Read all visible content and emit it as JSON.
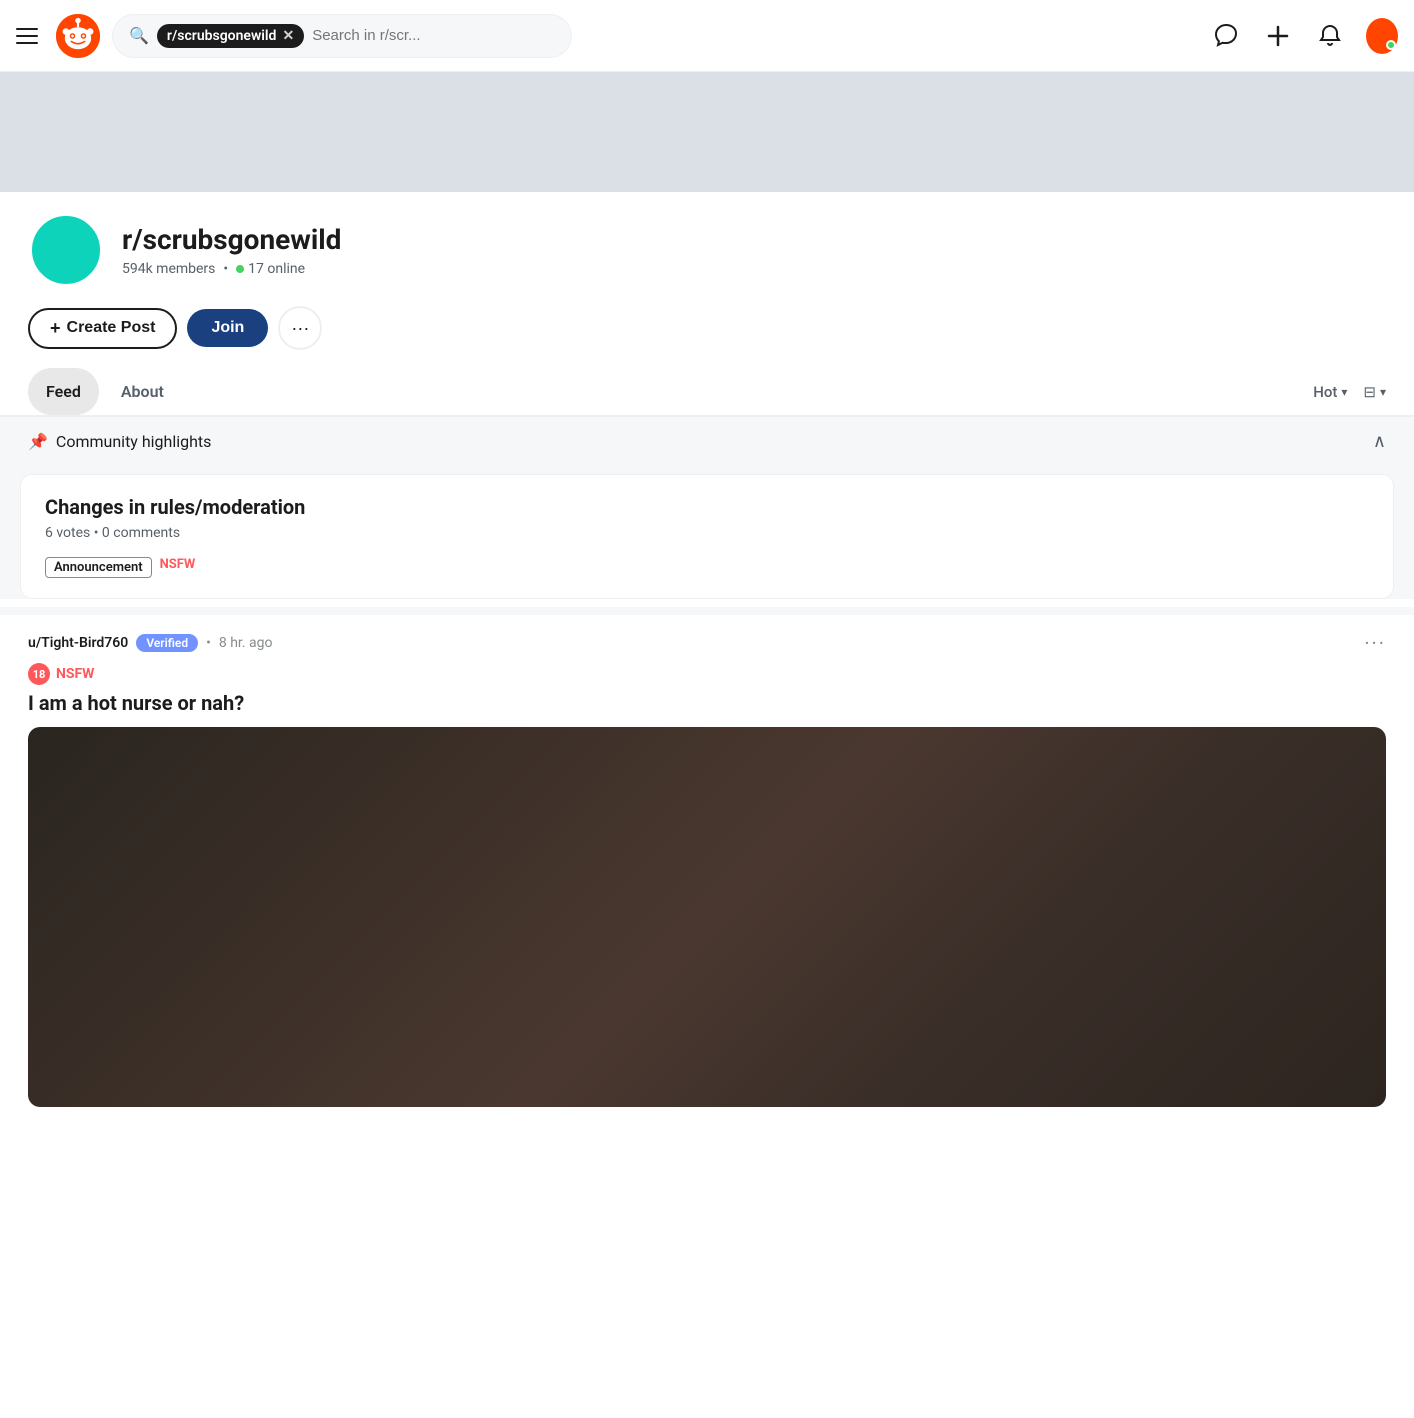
{
  "header": {
    "subreddit_name": "r/scrubsgonewild",
    "search_placeholder": "Search in r/scr...",
    "search_icon": "🔍",
    "online_dot_color": "#46d160"
  },
  "community": {
    "name": "r/scrubsgonewild",
    "members": "594k members",
    "online": "17 online",
    "create_post_label": "Create Post",
    "join_label": "Join",
    "more_label": "···"
  },
  "tabs": {
    "feed_label": "Feed",
    "about_label": "About",
    "sort_label": "Hot",
    "layout_label": "⊟"
  },
  "highlights": {
    "section_title": "Community highlights",
    "posts": [
      {
        "title": "Changes in rules/moderation",
        "votes": "6 votes",
        "comments": "0 comments",
        "tag1": "Announcement",
        "tag2": "NSFW"
      }
    ]
  },
  "feed": {
    "posts": [
      {
        "username": "u/Tight-Bird760",
        "verified": "Verified",
        "time": "8 hr. ago",
        "nsfw_badge": "18",
        "nsfw_text": "NSFW",
        "title": "I am a hot nurse or nah?"
      }
    ]
  }
}
